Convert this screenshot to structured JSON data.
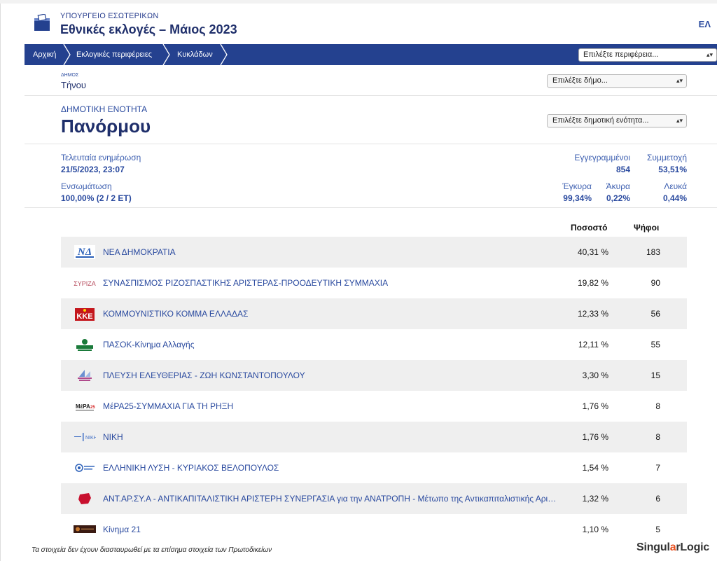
{
  "header": {
    "ministry": "ΥΠΟΥΡΓΕΙΟ ΕΣΩΤΕΡΙΚΩΝ",
    "title": "Εθνικές εκλογές – Μάιος 2023",
    "language": "ΕΛ"
  },
  "breadcrumbs": [
    "Αρχική",
    "Εκλογικές περιφέρειες",
    "Κυκλάδων"
  ],
  "region_select": "Επιλέξτε περιφέρεια...",
  "municipality": {
    "caption": "ΔΗΜΟΣ",
    "name": "Τήνου",
    "select": "Επιλέξτε δήμο..."
  },
  "municipal_unit": {
    "caption": "ΔΗΜΟΤΙΚΗ ΕΝΟΤΗΤΑ",
    "name": "Πανόρμου",
    "select": "Επιλέξτε δημοτική ενότητα..."
  },
  "stats": {
    "last_update_label": "Τελευταία ενημέρωση",
    "last_update": "21/5/2023, 23:07",
    "integration_label": "Ενσωμάτωση",
    "integration": "100,00% (2 / 2 ΕΤ)",
    "registered_label": "Εγγεγραμμένοι",
    "registered": "854",
    "turnout_label": "Συμμετοχή",
    "turnout": "53,51%",
    "valid_label": "Έγκυρα",
    "valid": "99,34%",
    "invalid_label": "Άκυρα",
    "invalid": "0,22%",
    "blank_label": "Λευκά",
    "blank": "0,44%"
  },
  "table": {
    "col_percent": "Ποσοστό",
    "col_votes": "Ψήφοι",
    "parties": [
      {
        "name": "ΝΕΑ ΔΗΜΟΚΡΑΤΙΑ",
        "percent": "40,31 %",
        "votes": "183",
        "logo": "nd-logo"
      },
      {
        "name": "ΣΥΝΑΣΠΙΣΜΟΣ ΡΙΖΟΣΠΑΣΤΙΚΗΣ ΑΡΙΣΤΕΡΑΣ-ΠΡΟΟΔΕΥΤΙΚΗ ΣΥΜΜΑΧΙΑ",
        "percent": "19,82 %",
        "votes": "90",
        "logo": "syriza-logo"
      },
      {
        "name": "ΚΟΜΜΟΥΝΙΣΤΙΚΟ ΚΟΜΜΑ ΕΛΛΑΔΑΣ",
        "percent": "12,33 %",
        "votes": "56",
        "logo": "kke-logo"
      },
      {
        "name": "ΠΑΣΟΚ-Κίνημα Αλλαγής",
        "percent": "12,11 %",
        "votes": "55",
        "logo": "pasok-logo"
      },
      {
        "name": "ΠΛΕΥΣΗ ΕΛΕΥΘΕΡΙΑΣ - ΖΩΗ ΚΩΝΣΤΑΝΤΟΠΟΥΛΟΥ",
        "percent": "3,30 %",
        "votes": "15",
        "logo": "plefsi-logo"
      },
      {
        "name": "ΜέΡΑ25-ΣΥΜΜΑΧΙΑ ΓΙΑ ΤΗ ΡΗΞΗ",
        "percent": "1,76 %",
        "votes": "8",
        "logo": "mera25-logo"
      },
      {
        "name": "ΝΙΚΗ",
        "percent": "1,76 %",
        "votes": "8",
        "logo": "niki-logo"
      },
      {
        "name": "ΕΛΛΗΝΙΚΗ ΛΥΣΗ - ΚΥΡΙΑΚΟΣ ΒΕΛΟΠΟΥΛΟΣ",
        "percent": "1,54 %",
        "votes": "7",
        "logo": "elliniki-lysi-logo"
      },
      {
        "name": "ΑΝΤ.ΑΡ.ΣΥ.Α - ΑΝΤΙΚΑΠΙΤΑΛΙΣΤΙΚΗ ΑΡΙΣΤΕΡΗ ΣΥΝΕΡΓΑΣΙΑ για την ΑΝΑΤΡΟΠΗ - Μέτωπο της Αντικαπιταλιστικής Αριστεράς",
        "percent": "1,32 %",
        "votes": "6",
        "logo": "antarsya-logo"
      },
      {
        "name": "Κίνημα 21",
        "percent": "1,10 %",
        "votes": "5",
        "logo": "kinima21-logo"
      }
    ]
  },
  "footer": {
    "note": "Τα στοιχεία δεν έχουν διασταυρωθεί με τα επίσημα στοιχεία των Πρωτοδικείων",
    "brand_a": "Singul",
    "brand_b": "a",
    "brand_c": "r",
    "brand_d": "Logic"
  },
  "colors": {
    "navbar": "#24418f",
    "title": "#1f2f6b",
    "link": "#2a4a9f",
    "row_shade": "#efefef",
    "brand_accent": "#e8501f"
  }
}
